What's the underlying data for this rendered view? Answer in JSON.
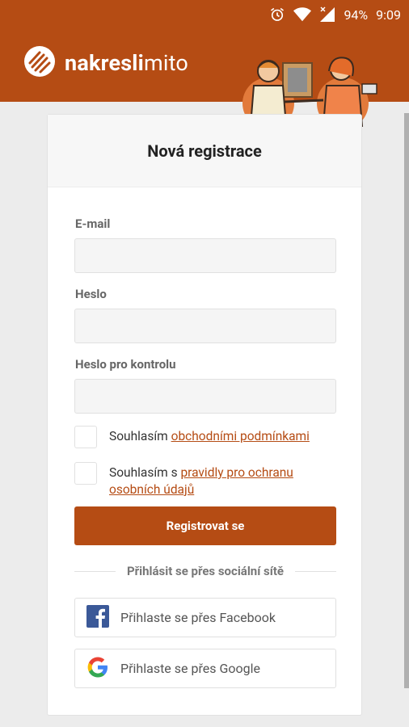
{
  "status_bar": {
    "battery": "94%",
    "time": "9:09"
  },
  "header": {
    "brand_bold": "nakresli",
    "brand_light": "mito"
  },
  "form": {
    "title": "Nová registrace",
    "email_label": "E-mail",
    "email_value": "",
    "password_label": "Heslo",
    "password_value": "",
    "password_confirm_label": "Heslo pro kontrolu",
    "password_confirm_value": "",
    "terms_prefix": "Souhlasím ",
    "terms_link": "obchodními podmínkami",
    "privacy_prefix": "Souhlasím s ",
    "privacy_link": "pravidly pro ochranu osobních údajů",
    "submit_label": "Registrovat se",
    "social_divider": "Přihlásit se přes sociální sítě",
    "facebook_label": "Přihlaste se přes Facebook",
    "google_label": "Přihlaste se přes Google"
  },
  "colors": {
    "brand": "#b54c14",
    "background": "#ececec"
  }
}
